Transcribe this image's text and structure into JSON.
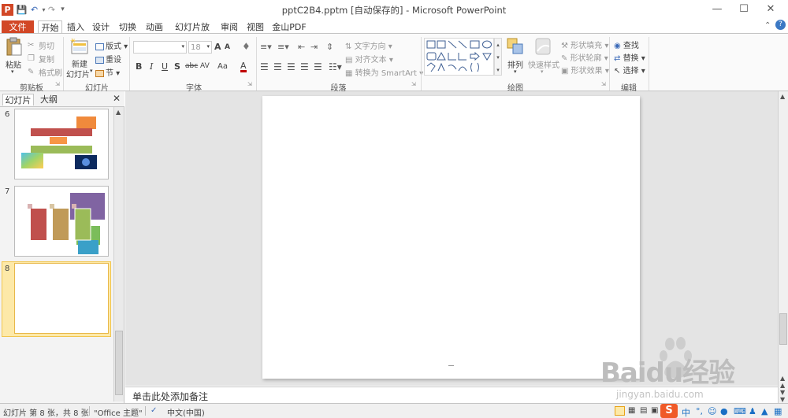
{
  "window": {
    "title": "pptC2B4.pptm [自动保存的] - Microsoft PowerPoint",
    "help_label": "?"
  },
  "tabs": [
    {
      "label": "文件"
    },
    {
      "label": "开始"
    },
    {
      "label": "插入"
    },
    {
      "label": "设计"
    },
    {
      "label": "切换"
    },
    {
      "label": "动画"
    },
    {
      "label": "幻灯片放映"
    },
    {
      "label": "审阅"
    },
    {
      "label": "视图"
    },
    {
      "label": "金山PDF"
    }
  ],
  "ribbon": {
    "clipboard": {
      "label": "剪贴板",
      "paste": "粘贴",
      "cut": "剪切",
      "copy": "复制",
      "format_painter": "格式刷"
    },
    "slides": {
      "label": "幻灯片",
      "new_slide_line1": "新建",
      "new_slide_line2": "幻灯片",
      "layout": "版式",
      "reset": "重设",
      "section": "节"
    },
    "font": {
      "label": "字体",
      "font_name": "",
      "font_size": "18",
      "bold": "B",
      "italic": "I",
      "underline": "U",
      "shadow": "S",
      "strike": "abc",
      "spacing": "AV",
      "case": "Aa",
      "grow": "A",
      "shrink": "A",
      "color": "A"
    },
    "paragraph": {
      "label": "段落",
      "text_direction": "文字方向",
      "align_text": "对齐文本",
      "convert_smartart": "转换为 SmartArt"
    },
    "drawing": {
      "label": "绘图",
      "arrange": "排列",
      "quick_styles": "快速样式",
      "shape_fill": "形状填充",
      "shape_outline": "形状轮廓",
      "shape_effects": "形状效果"
    },
    "editing": {
      "label": "编辑",
      "find": "查找",
      "replace": "替换",
      "select": "选择"
    }
  },
  "left_panel": {
    "tab_slides": "幻灯片",
    "tab_outline": "大纲",
    "thumbnails": [
      {
        "number": "6"
      },
      {
        "number": "7"
      },
      {
        "number": "8"
      }
    ]
  },
  "notes": {
    "placeholder": "单击此处添加备注"
  },
  "status": {
    "slide_info": "幻灯片 第 8 张，共 8 张",
    "theme": "\"Office 主题\"",
    "language": "中文(中国)",
    "ime": "中"
  },
  "watermark": {
    "brand": "Baidu经验",
    "url": "jingyan.baidu.com"
  },
  "colors": {
    "file_tab": "#d24726",
    "slide_bg": "#ffffff",
    "workspace": "#e4e4e4"
  }
}
